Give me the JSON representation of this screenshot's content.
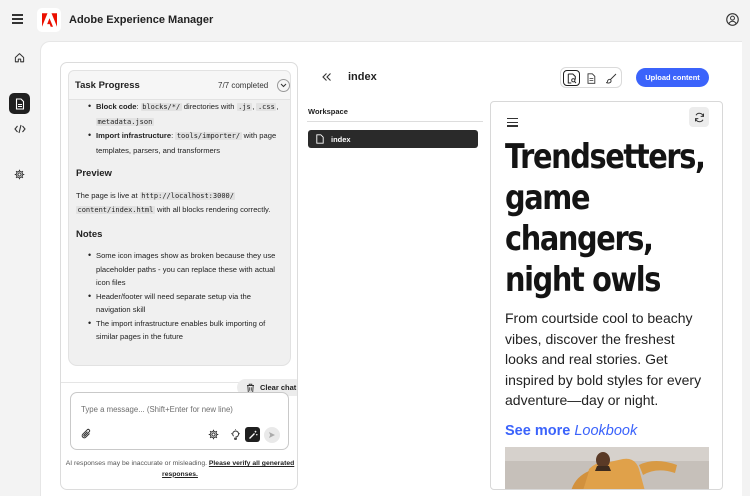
{
  "app": {
    "title": "Adobe Experience Manager"
  },
  "task": {
    "title": "Task Progress",
    "count": "7/7 completed",
    "block_code_label": "Block code",
    "block_code_path": "blocks/*/",
    "block_code_mid": " directories with ",
    "ext_js": ".js",
    "ext_css": ".css",
    "ext_json": "metadata.json",
    "import_label": "Import infrastructure",
    "import_path": "tools/importer/",
    "import_tail": " with page templates, parsers, and transformers",
    "preview_heading": "Preview",
    "preview_pre": "The page is live at ",
    "preview_url1": "http://localhost:3000/",
    "preview_url2": "content/index.html",
    "preview_post": " with all blocks rendering correctly.",
    "notes_heading": "Notes",
    "notes": [
      "Some icon images show as broken because they use placeholder paths - you can replace these with actual icon files",
      "Header/footer will need separate setup via the navigation skill",
      "The import infrastructure enables bulk importing of similar pages in the future"
    ],
    "clear_chat": "Clear chat"
  },
  "composer": {
    "placeholder": "Type a message... (Shift+Enter for new line)",
    "icons": [
      "paperclip-icon",
      "gear-icon",
      "lightbulb-icon",
      "magic-wand-icon",
      "send-icon"
    ]
  },
  "disclaimer": {
    "text": "AI responses may be inaccurate or misleading. ",
    "link": "Please verify all generated responses."
  },
  "editor": {
    "doc_title": "index",
    "upload_label": "Upload content",
    "workspace_label": "Workspace",
    "workspace_items": [
      {
        "label": "index"
      }
    ]
  },
  "preview": {
    "headline": "Trendsetters, game changers, night owls",
    "paragraph": "From courtside cool to beachy vibes, discover the freshest looks and real stories. Get inspired by bold styles for every adventure—day or night.",
    "link_prefix": "See more ",
    "link_italic": "Lookbook"
  },
  "colors": {
    "accent": "#3b63fb",
    "brand": "#eb1000",
    "dark": "#1f1f1f"
  }
}
